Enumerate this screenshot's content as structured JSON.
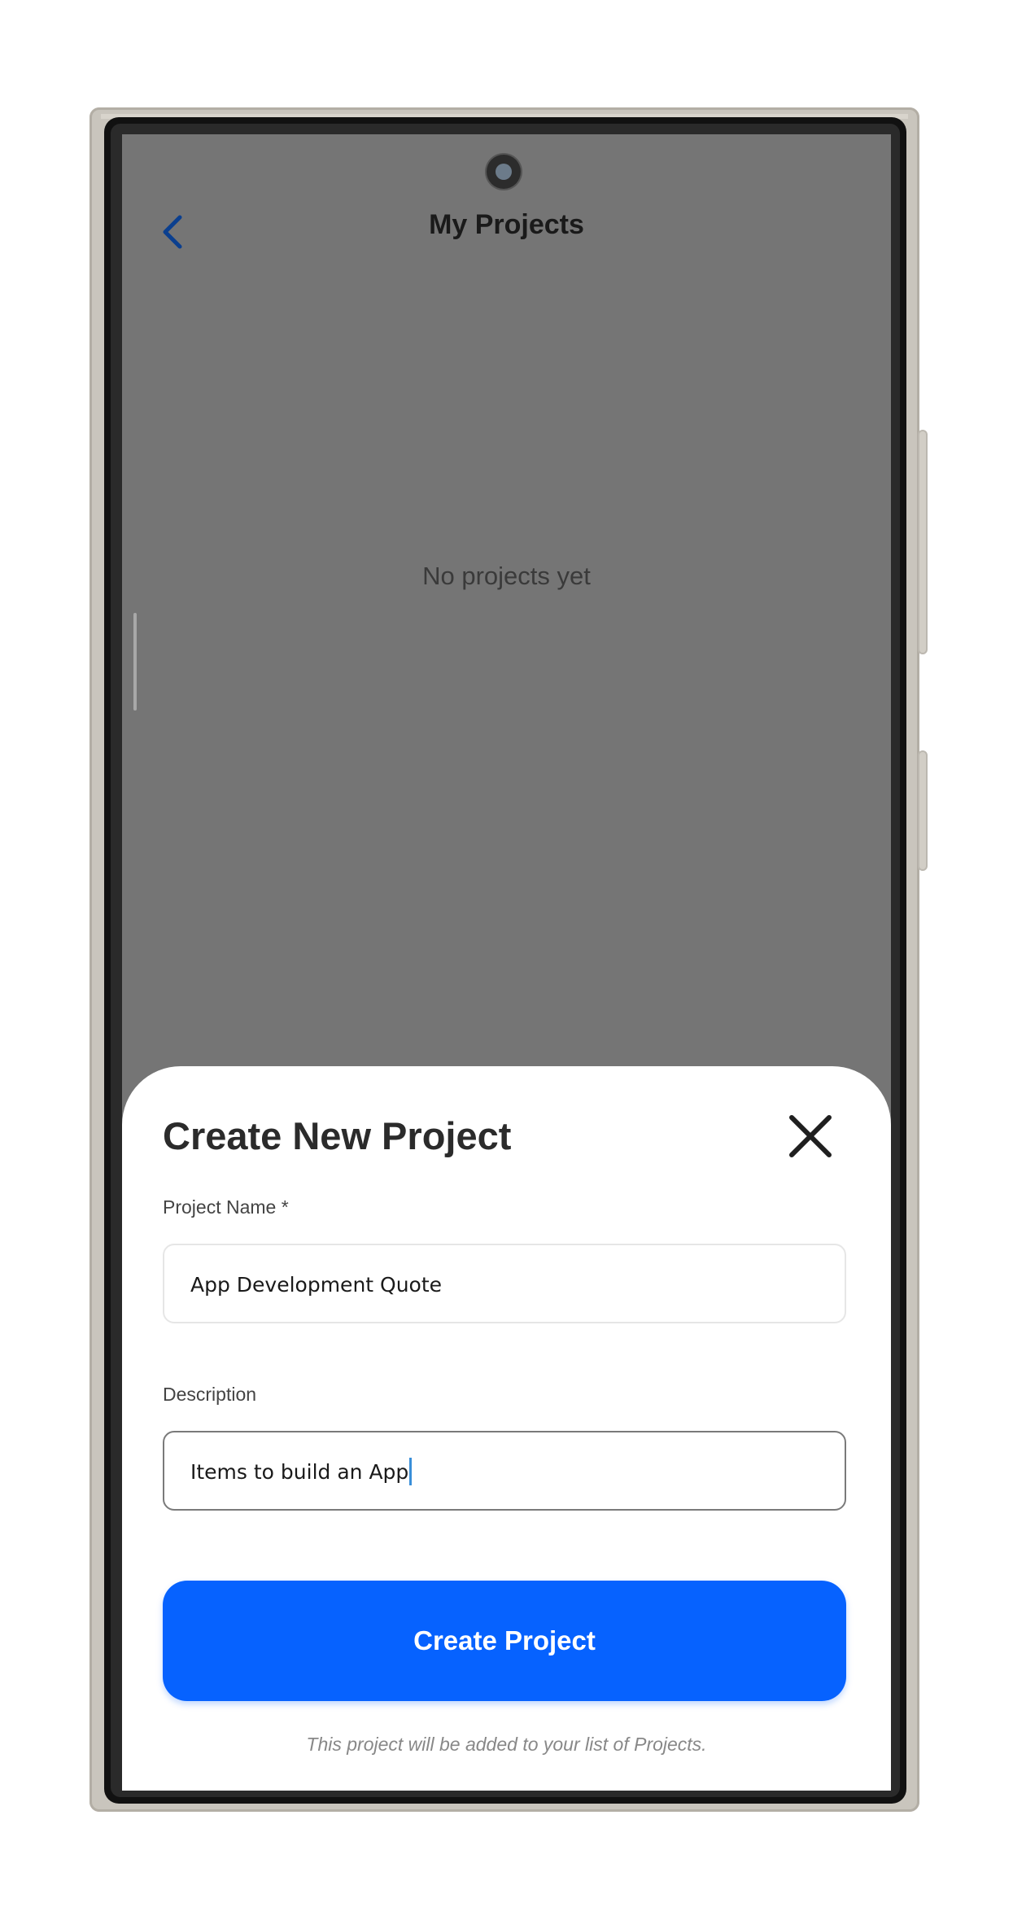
{
  "header": {
    "title": "My Projects",
    "back_icon": "chevron-left-icon"
  },
  "main": {
    "empty_message": "No projects yet"
  },
  "sheet": {
    "title": "Create New Project",
    "close_icon": "close-icon",
    "project_name": {
      "label": "Project Name *",
      "value": "App Development Quote"
    },
    "description": {
      "label": "Description",
      "value": "Items to build an App"
    },
    "submit_label": "Create Project",
    "footnote": "This project will be added to your list of Projects."
  },
  "colors": {
    "accent": "#0662ff",
    "back_icon": "#0b3f8f",
    "overlay": "#757575",
    "caret": "#3a8fd9"
  }
}
